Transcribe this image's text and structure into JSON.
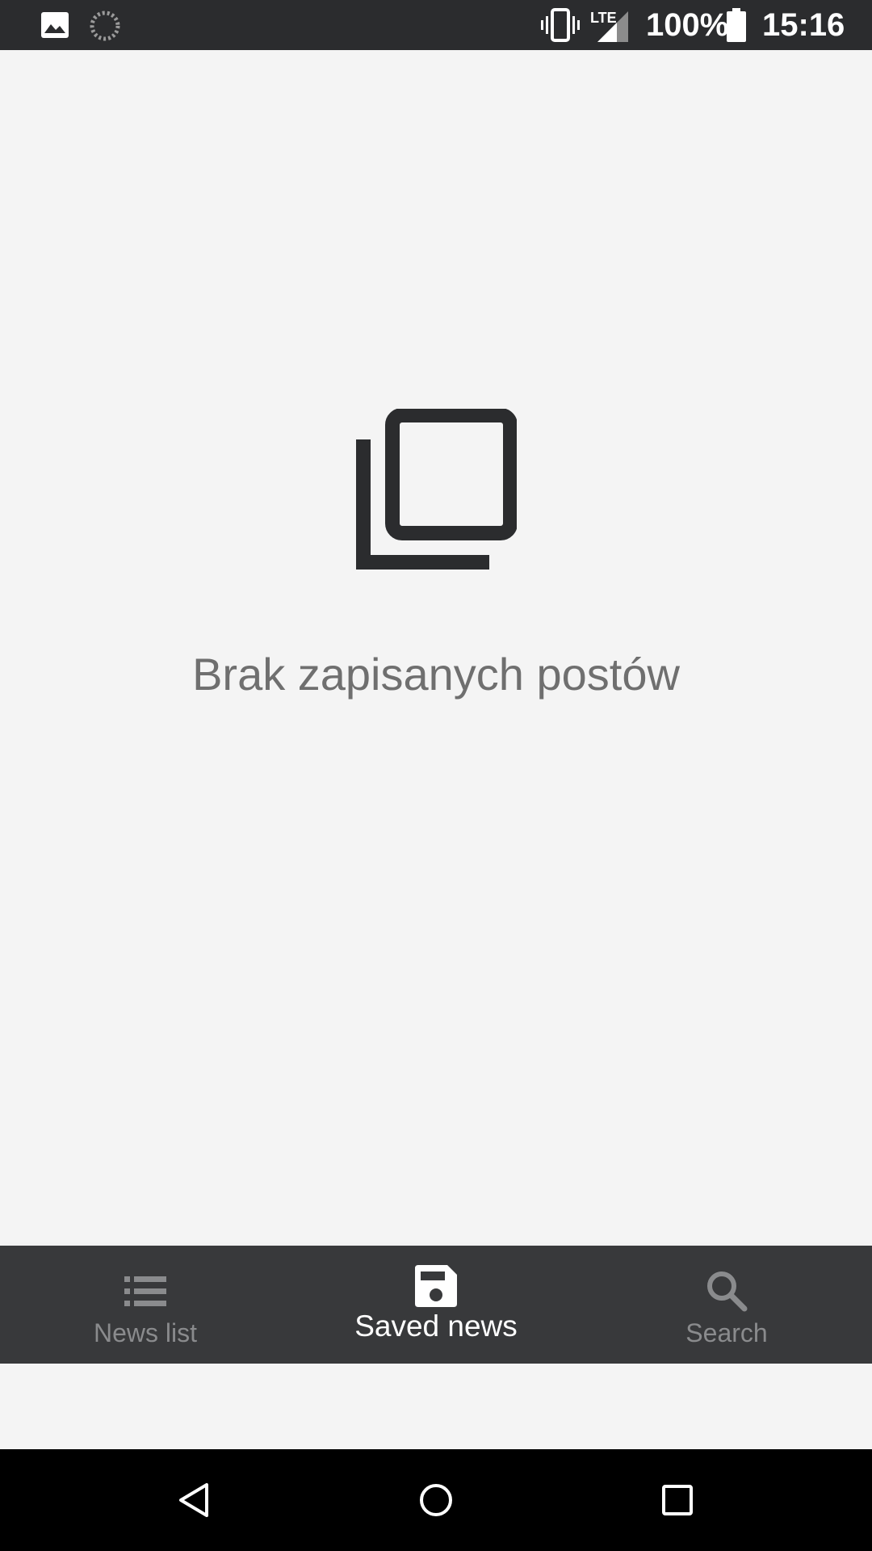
{
  "status_bar": {
    "battery_percent": "100%",
    "time": "15:16",
    "network": "LTE",
    "icons": [
      "image-icon",
      "loading-icon",
      "vibrate-icon",
      "signal-icon",
      "battery-icon"
    ]
  },
  "empty_state": {
    "icon": "copy-icon",
    "message": "Brak zapisanych postów"
  },
  "bottom_nav": {
    "items": [
      {
        "label": "News list",
        "icon": "list-icon",
        "active": false
      },
      {
        "label": "Saved news",
        "icon": "save-icon",
        "active": true
      },
      {
        "label": "Search",
        "icon": "search-icon",
        "active": false
      }
    ]
  },
  "system_nav": {
    "buttons": [
      "back-icon",
      "home-icon",
      "recents-icon"
    ]
  },
  "colors": {
    "status_bar_bg": "#2b2c2e",
    "background": "#f4f4f4",
    "nav_bg": "#38393b",
    "nav_active": "#ffffff",
    "nav_inactive": "#8a8b8d",
    "empty_text": "#6f6f6f",
    "icon_dark": "#2b2c2e"
  }
}
